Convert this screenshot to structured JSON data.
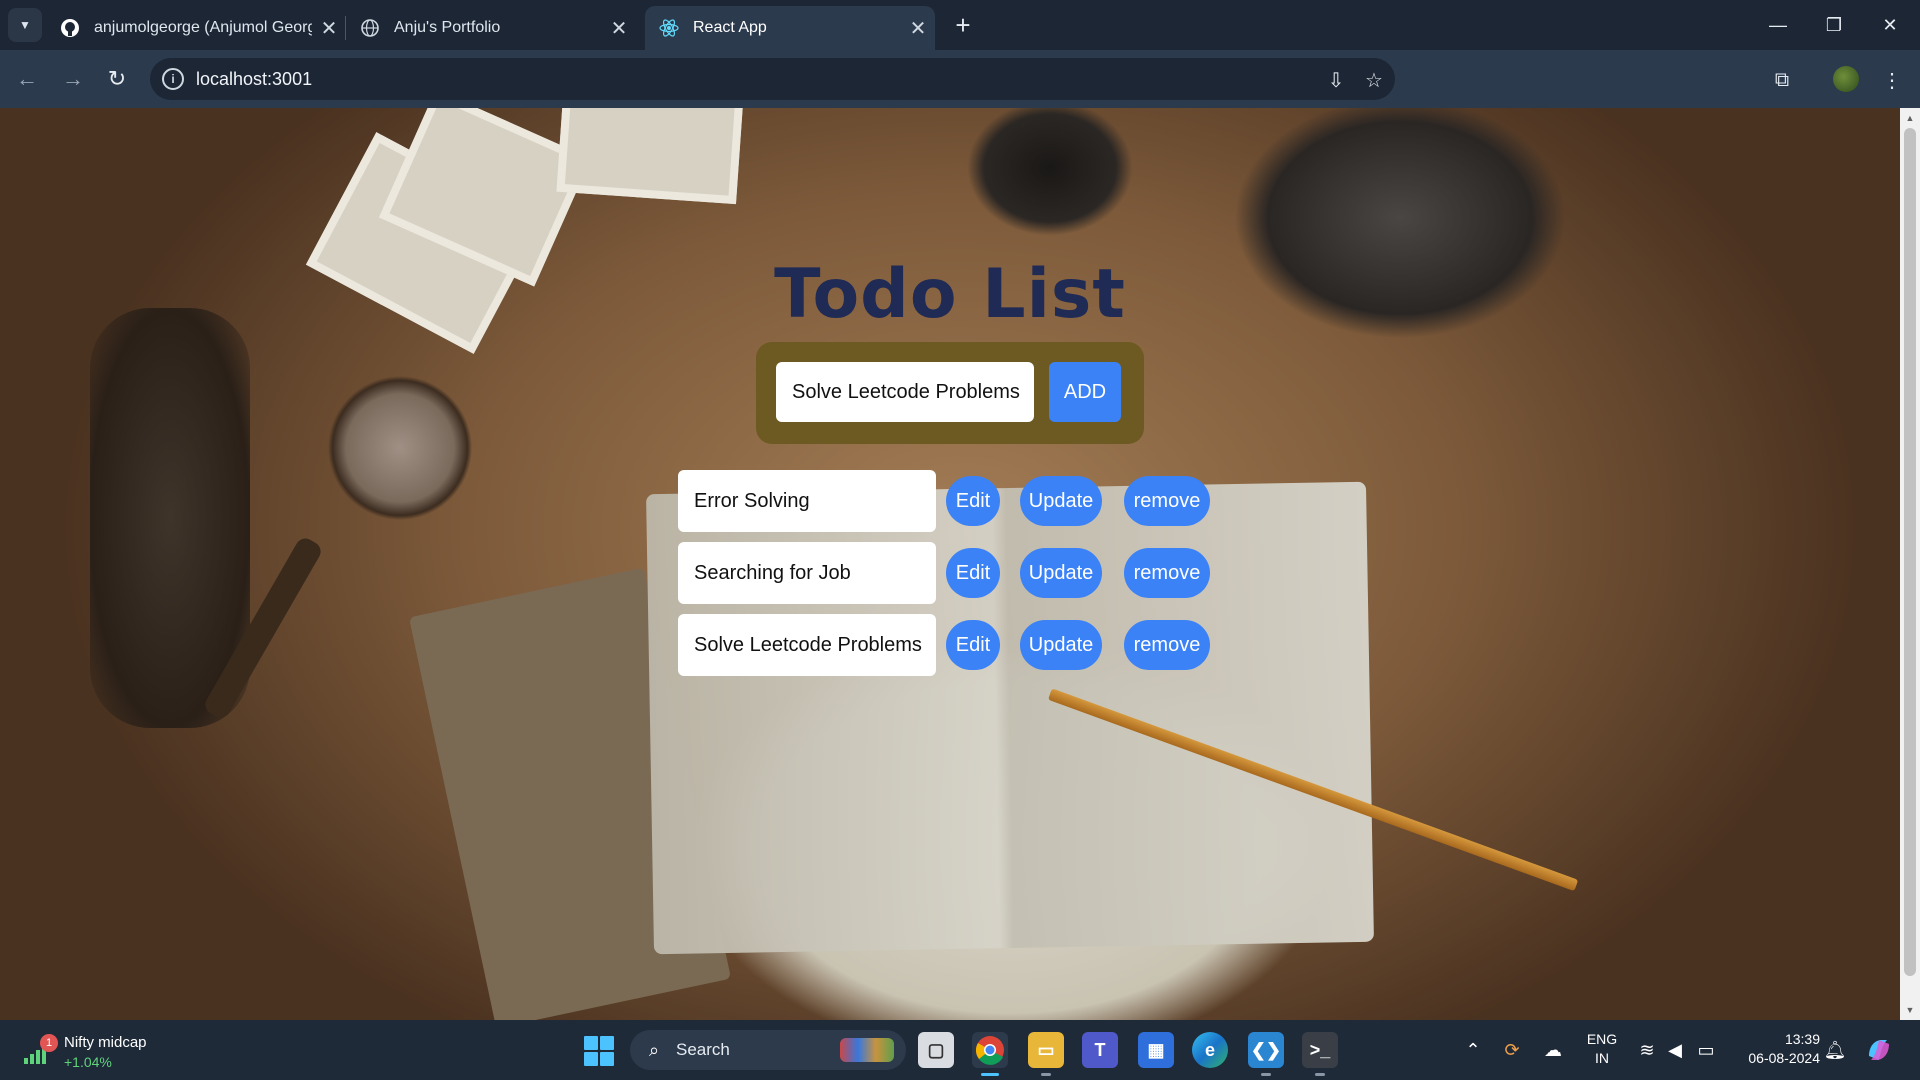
{
  "browser": {
    "tabs": [
      {
        "title": "anjumolgeorge (Anjumol George)",
        "favicon": "github-icon",
        "active": false
      },
      {
        "title": "Anju's Portfolio",
        "favicon": "globe-icon",
        "active": false
      },
      {
        "title": "React App",
        "favicon": "react-icon",
        "active": true
      }
    ],
    "url": "localhost:3001"
  },
  "app": {
    "title": "Todo List",
    "input_value": "Solve Leetcode Problems",
    "add_label": "ADD",
    "todos": [
      {
        "text": "Error Solving",
        "edit": "Edit",
        "update": "Update",
        "remove": "remove"
      },
      {
        "text": "Searching for Job",
        "edit": "Edit",
        "update": "Update",
        "remove": "remove"
      },
      {
        "text": "Solve Leetcode Problems",
        "edit": "Edit",
        "update": "Update",
        "remove": "remove"
      }
    ],
    "colors": {
      "accent": "#3b82f6",
      "title": "#1f2a55",
      "panel": "#6d5a22"
    }
  },
  "taskbar": {
    "widget": {
      "badge": "1",
      "name": "Nifty midcap",
      "change": "+1.04%"
    },
    "search_label": "Search",
    "language": {
      "line1": "ENG",
      "line2": "IN"
    },
    "time": "13:39",
    "date": "06-08-2024"
  }
}
